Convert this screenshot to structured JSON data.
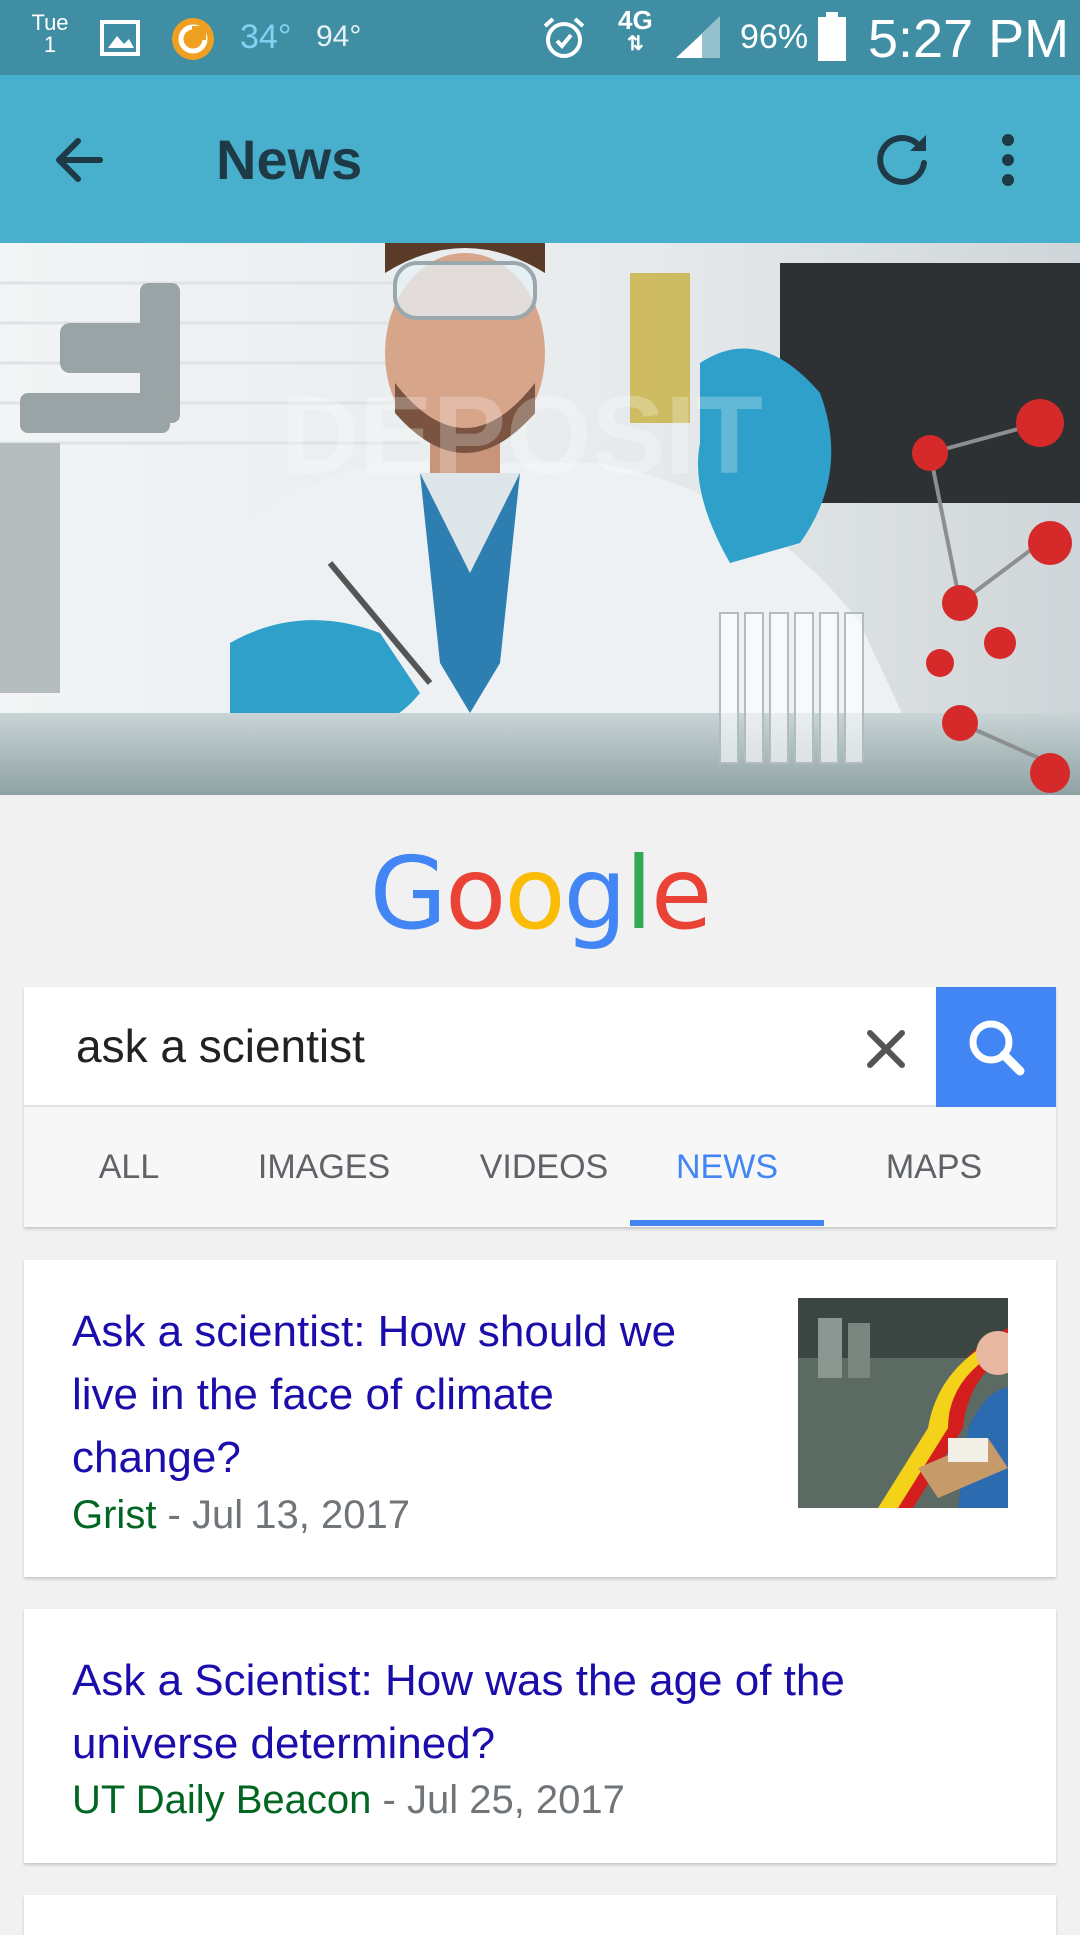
{
  "status_bar": {
    "day": "Tue",
    "date": "1",
    "temp_current": "34°",
    "temp_high": "94°",
    "network": "4G",
    "battery": "96%",
    "time": "5:27 PM",
    "icons": [
      "gallery-icon",
      "weather-circle-icon",
      "alarm-icon",
      "signal-icon",
      "battery-icon"
    ]
  },
  "app_bar": {
    "title": "News",
    "icons": [
      "back-arrow-icon",
      "refresh-icon",
      "more-vert-icon"
    ]
  },
  "logo": "Google",
  "search": {
    "query": "ask a scientist",
    "icons": [
      "clear-icon",
      "search-icon"
    ]
  },
  "tabs": {
    "items": [
      "ALL",
      "IMAGES",
      "VIDEOS",
      "NEWS",
      "MAPS"
    ],
    "active": "NEWS"
  },
  "results": [
    {
      "title_lines": [
        "Ask a scientist: How should we",
        "live in the face of climate",
        "change?"
      ],
      "source": "Grist",
      "date": " - Jul 13, 2017",
      "has_thumbnail": true
    },
    {
      "title_lines": [
        "Ask a Scientist: How was the age of the",
        "universe determined?"
      ],
      "source": "UT Daily Beacon",
      "date": " - Jul 25, 2017",
      "has_thumbnail": false
    }
  ],
  "colors": {
    "status_bar": "#3f8ea3",
    "app_bar": "#48b0cc",
    "link": "#1a0dab",
    "source": "#006621",
    "accent": "#4285f4"
  }
}
